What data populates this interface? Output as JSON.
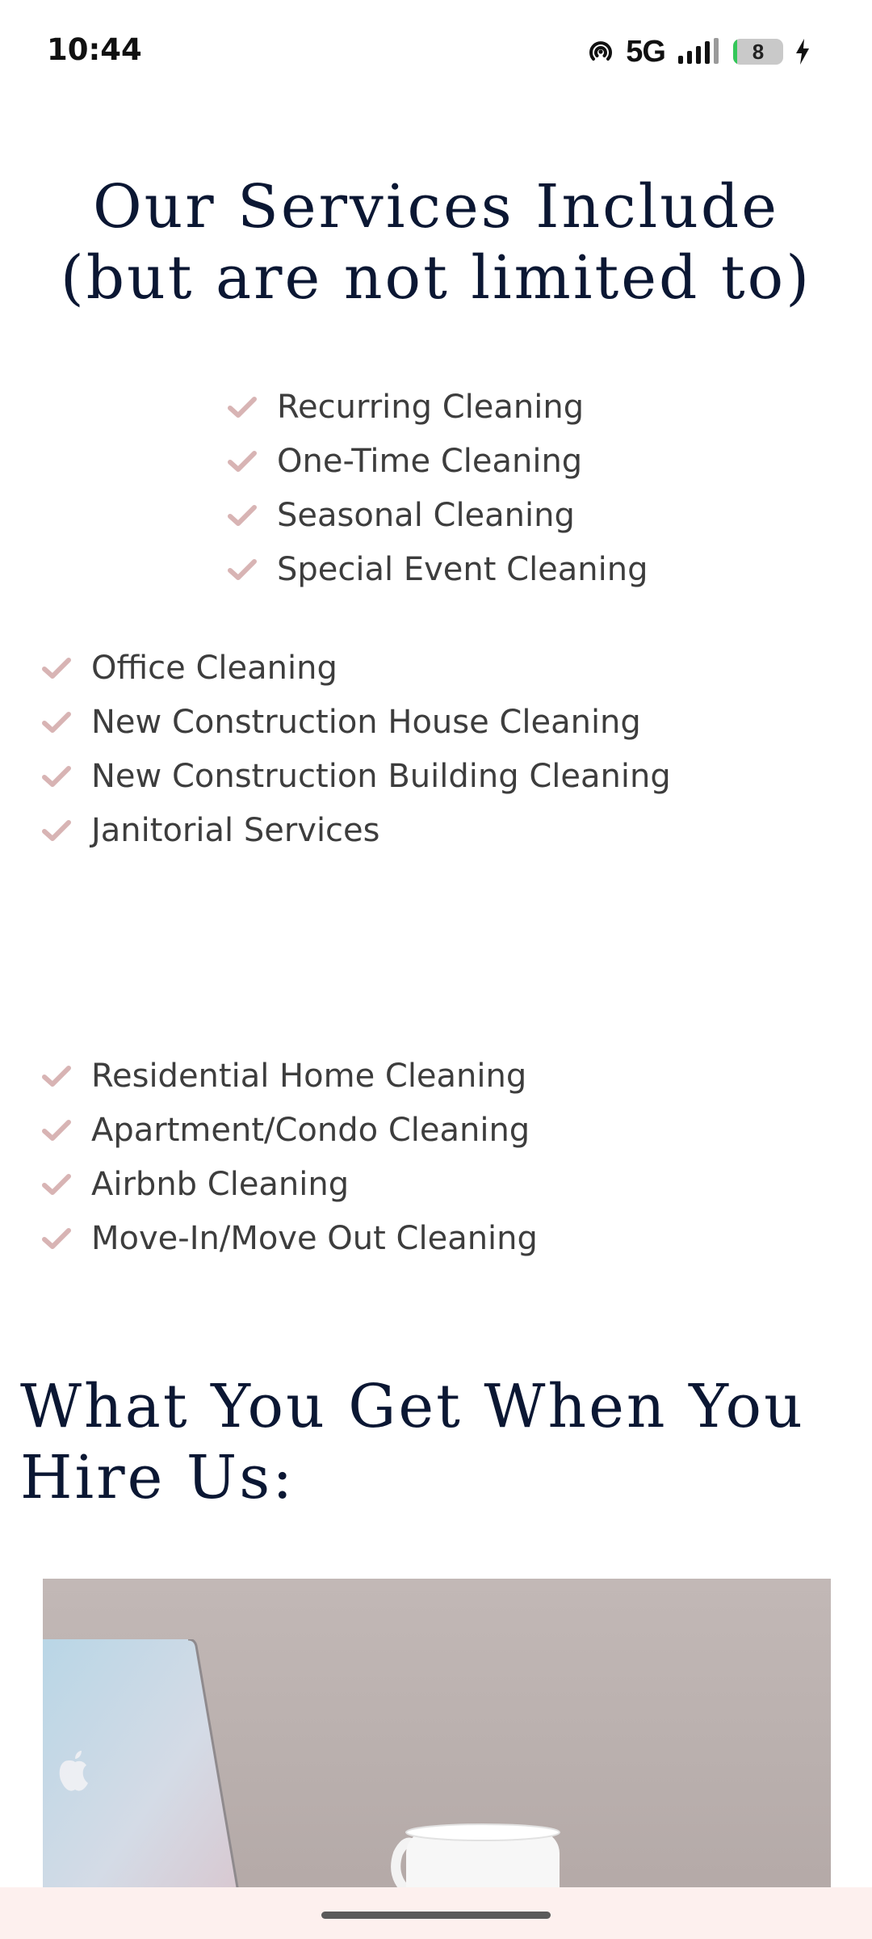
{
  "status_bar": {
    "time": "10:44",
    "network": "5G",
    "battery_level": "8",
    "icons": [
      "hotspot-icon",
      "signal-icon",
      "battery-icon",
      "charging-icon"
    ]
  },
  "services": {
    "title": "Our Services Include (but are not limited to)",
    "groups": [
      {
        "items": [
          "Recurring Cleaning",
          "One-Time Cleaning",
          "Seasonal Cleaning",
          "Special Event Cleaning"
        ]
      },
      {
        "items": [
          "Office Cleaning",
          "New Construction House Cleaning",
          "New Construction Building Cleaning",
          "Janitorial Services"
        ]
      },
      {
        "items": [
          "Residential Home Cleaning",
          "Apartment/Condo Cleaning",
          "Airbnb Cleaning",
          "Move-In/Move Out Cleaning"
        ]
      }
    ]
  },
  "hire": {
    "title": "What You Get When You Hire Us:"
  },
  "colors": {
    "heading": "#0b1733",
    "body_text": "#3d3d3d",
    "check_accent": "#d8b4b4",
    "nav_bar_bg": "#fdf0ee"
  }
}
